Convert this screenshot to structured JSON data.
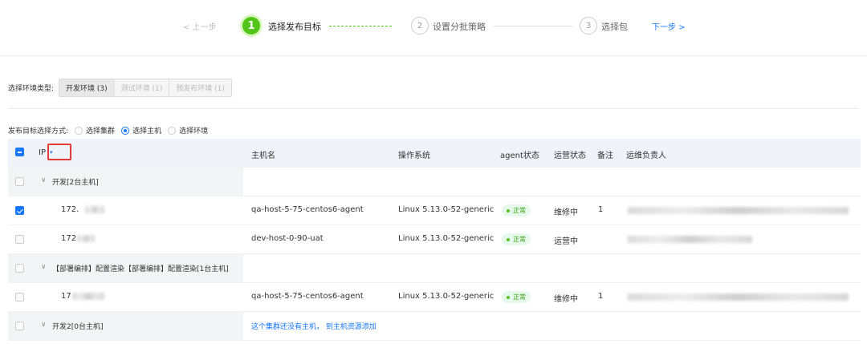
{
  "stepper": {
    "prev_label": "< 上一步",
    "steps": [
      {
        "num": "1",
        "label": "选择发布目标"
      },
      {
        "num": "2",
        "label": "设置分批策略"
      },
      {
        "num": "3",
        "label": "选择包"
      }
    ],
    "next_label": "下一步 >"
  },
  "env": {
    "label": "选择环境类型:",
    "options": [
      "开发环境 (3)",
      "测试环境 (1)",
      "预发布环境 (1)"
    ],
    "selected": "开发环境 (3)"
  },
  "method": {
    "label": "发布目标选择方式:",
    "options": [
      "选择集群",
      "选择主机",
      "选择环境"
    ],
    "selected": "选择主机"
  },
  "table": {
    "headers": {
      "ip": "IP",
      "hostname": "主机名",
      "os": "操作系统",
      "agent": "agent状态",
      "ops": "运营状态",
      "note": "备注",
      "owner": "运维负责人"
    },
    "groups": [
      {
        "label": "开发[2台主机]"
      },
      {
        "label": "【部署编排】配置渲染【部署编排】配置渲染[1台主机]"
      },
      {
        "label": "开发2[0台主机]",
        "empty_text": "这个集群还没有主机， 到主机资源添加"
      }
    ],
    "rows": [
      {
        "ip": "172.",
        "hostname": "qa-host-5-75-centos6-agent",
        "os": "Linux 5.13.0-52-generic",
        "agent": "正常",
        "ops": "维修中",
        "note": "1",
        "checked": true
      },
      {
        "ip": "172",
        "hostname": "dev-host-0-90-uat",
        "os": "Linux 5.13.0-52-generic",
        "agent": "正常",
        "ops": "运营中",
        "note": "",
        "checked": false
      },
      {
        "ip": "17",
        "hostname": "qa-host-5-75-centos6-agent",
        "os": "Linux 5.13.0-52-generic",
        "agent": "正常",
        "ops": "维修中",
        "note": "1",
        "checked": false
      }
    ]
  }
}
